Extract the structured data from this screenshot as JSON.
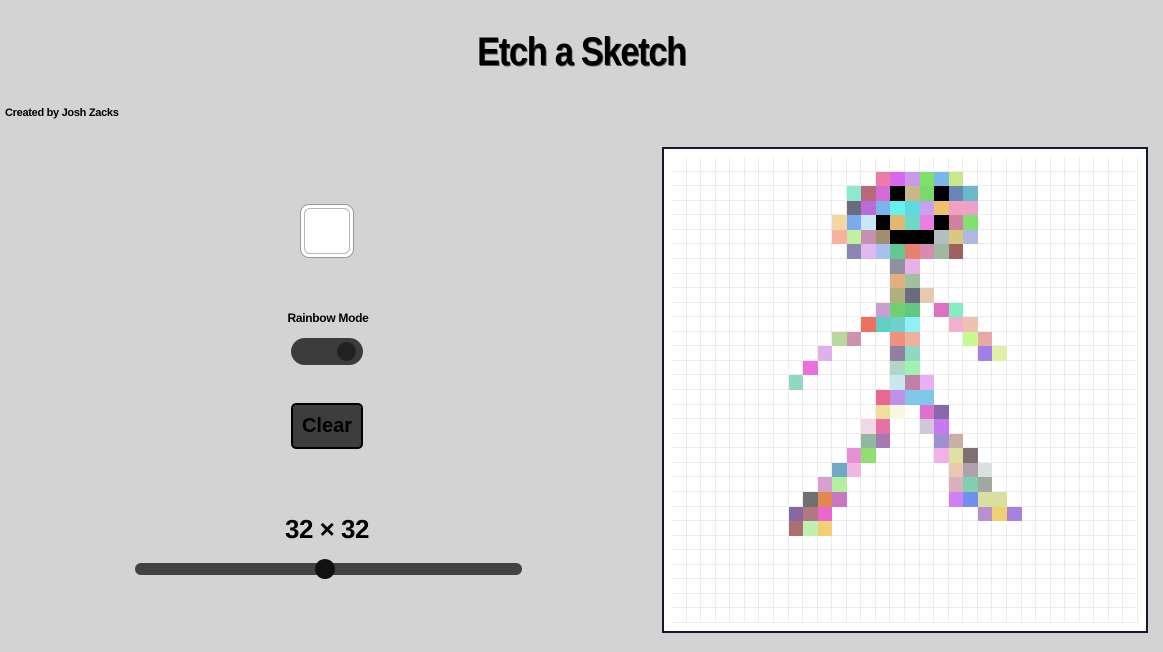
{
  "app": {
    "title": "Etch a Sketch",
    "credit": "Created by Josh Zacks"
  },
  "controls": {
    "color_picker_value": "#ffffff",
    "rainbow_label": "Rainbow Mode",
    "rainbow_mode_on": true,
    "clear_label": "Clear",
    "grid_size_label": "32 × 32",
    "grid_size": 32,
    "grid_size_slider_fraction": 0.49
  },
  "colors": {
    "background": "#d3d3d3",
    "control_dark": "#3d3d3d",
    "board_border": "#121830",
    "grid_line": "#ececec",
    "cell_blank": "#ffffff"
  },
  "board": {
    "rows": 32,
    "cols": 32,
    "painted_cells": [
      [
        1,
        14,
        "#ee7aa6"
      ],
      [
        1,
        15,
        "#dd66ee"
      ],
      [
        1,
        16,
        "#c99be6"
      ],
      [
        1,
        17,
        "#7ee06a"
      ],
      [
        1,
        18,
        "#79b9e8"
      ],
      [
        1,
        19,
        "#c9e88a"
      ],
      [
        2,
        12,
        "#8ee8cf"
      ],
      [
        2,
        13,
        "#b56b7a"
      ],
      [
        2,
        14,
        "#d56bd9"
      ],
      [
        2,
        15,
        "#000000"
      ],
      [
        2,
        16,
        "#c9b98a"
      ],
      [
        2,
        17,
        "#7bd86f"
      ],
      [
        2,
        18,
        "#000000"
      ],
      [
        2,
        19,
        "#6a86b9"
      ],
      [
        2,
        20,
        "#6ab9c9"
      ],
      [
        3,
        12,
        "#6b6b7e"
      ],
      [
        3,
        13,
        "#b96bd9"
      ],
      [
        3,
        14,
        "#7ab4e8"
      ],
      [
        3,
        15,
        "#66f0f0"
      ],
      [
        3,
        16,
        "#5ed9e0"
      ],
      [
        3,
        17,
        "#c8a0f0"
      ],
      [
        3,
        18,
        "#f0c070"
      ],
      [
        3,
        19,
        "#f0a0c0"
      ],
      [
        3,
        20,
        "#f0a0c8"
      ],
      [
        4,
        11,
        "#f0d8a0"
      ],
      [
        4,
        12,
        "#7aaaf0"
      ],
      [
        4,
        13,
        "#c8e8f8"
      ],
      [
        4,
        14,
        "#000000"
      ],
      [
        4,
        15,
        "#e0b870"
      ],
      [
        4,
        16,
        "#70d8c0"
      ],
      [
        4,
        17,
        "#e880e0"
      ],
      [
        4,
        18,
        "#000000"
      ],
      [
        4,
        19,
        "#d080a0"
      ],
      [
        4,
        20,
        "#80e070"
      ],
      [
        5,
        11,
        "#f8b0a0"
      ],
      [
        5,
        12,
        "#c0f0a0"
      ],
      [
        5,
        13,
        "#c890b0"
      ],
      [
        5,
        14,
        "#a09070"
      ],
      [
        5,
        15,
        "#000000"
      ],
      [
        5,
        16,
        "#000000"
      ],
      [
        5,
        17,
        "#000000"
      ],
      [
        5,
        18,
        "#b0c0c0"
      ],
      [
        5,
        19,
        "#d8c880"
      ],
      [
        5,
        20,
        "#b0b8e0"
      ],
      [
        6,
        12,
        "#8888b0"
      ],
      [
        6,
        13,
        "#e0b8f0"
      ],
      [
        6,
        14,
        "#a8c0f0"
      ],
      [
        6,
        15,
        "#60c890"
      ],
      [
        6,
        16,
        "#e88070"
      ],
      [
        6,
        17,
        "#d88ab0"
      ],
      [
        6,
        18,
        "#a0b8a0"
      ],
      [
        6,
        19,
        "#a06060"
      ],
      [
        7,
        15,
        "#9090a0"
      ],
      [
        7,
        16,
        "#e8b0e8"
      ],
      [
        8,
        15,
        "#e0b080"
      ],
      [
        8,
        16,
        "#a0c0a0"
      ],
      [
        9,
        15,
        "#b0b080"
      ],
      [
        9,
        16,
        "#6a6a80"
      ],
      [
        9,
        17,
        "#e8c8b0"
      ],
      [
        10,
        14,
        "#c8a0d0"
      ],
      [
        10,
        15,
        "#70d070"
      ],
      [
        10,
        16,
        "#60c880"
      ],
      [
        10,
        18,
        "#e070c0"
      ],
      [
        10,
        19,
        "#80f0c0"
      ],
      [
        11,
        13,
        "#f07060"
      ],
      [
        11,
        14,
        "#60d0c0"
      ],
      [
        11,
        15,
        "#70d0d0"
      ],
      [
        11,
        16,
        "#90f0f8"
      ],
      [
        11,
        19,
        "#f0b0d0"
      ],
      [
        11,
        20,
        "#f0c0b0"
      ],
      [
        12,
        11,
        "#b8d8a0"
      ],
      [
        12,
        12,
        "#d090b0"
      ],
      [
        12,
        15,
        "#f09080"
      ],
      [
        12,
        16,
        "#f0b0a0"
      ],
      [
        12,
        20,
        "#c8f890"
      ],
      [
        12,
        21,
        "#e8a8a8"
      ],
      [
        13,
        10,
        "#e0b0e8"
      ],
      [
        13,
        15,
        "#9080a0"
      ],
      [
        13,
        16,
        "#90d8c0"
      ],
      [
        13,
        21,
        "#a080e8"
      ],
      [
        13,
        22,
        "#e0f0a8"
      ],
      [
        14,
        9,
        "#e870d8"
      ],
      [
        14,
        15,
        "#b0d8c8"
      ],
      [
        14,
        16,
        "#a0f0b0"
      ],
      [
        15,
        8,
        "#90d8c0"
      ],
      [
        15,
        15,
        "#c8e8f0"
      ],
      [
        15,
        16,
        "#c080a8"
      ],
      [
        15,
        17,
        "#e8b0f0"
      ],
      [
        16,
        14,
        "#e86890"
      ],
      [
        16,
        15,
        "#c090e8"
      ],
      [
        16,
        16,
        "#80c8e8"
      ],
      [
        16,
        17,
        "#80c8e8"
      ],
      [
        17,
        14,
        "#f0e0a0"
      ],
      [
        17,
        15,
        "#f8f8e0"
      ],
      [
        17,
        17,
        "#e070d0"
      ],
      [
        17,
        18,
        "#8868a8"
      ],
      [
        18,
        13,
        "#f0d8e8"
      ],
      [
        18,
        14,
        "#e870a8"
      ],
      [
        18,
        17,
        "#d0c8d8"
      ],
      [
        18,
        18,
        "#c878f0"
      ],
      [
        19,
        13,
        "#90b8a0"
      ],
      [
        19,
        14,
        "#a878b0"
      ],
      [
        19,
        18,
        "#a090d0"
      ],
      [
        19,
        19,
        "#c8b0a8"
      ],
      [
        20,
        12,
        "#e890d8"
      ],
      [
        20,
        13,
        "#90e070"
      ],
      [
        20,
        18,
        "#f0b0e8"
      ],
      [
        20,
        19,
        "#e0e0a0"
      ],
      [
        20,
        20,
        "#807070"
      ],
      [
        21,
        11,
        "#70a8c8"
      ],
      [
        21,
        12,
        "#f0b8e0"
      ],
      [
        21,
        19,
        "#e8c8b0"
      ],
      [
        21,
        20,
        "#b0a0b0"
      ],
      [
        21,
        21,
        "#d8e0e0"
      ],
      [
        22,
        10,
        "#d8a0d0"
      ],
      [
        22,
        11,
        "#b0f0a0"
      ],
      [
        22,
        19,
        "#d8b0c0"
      ],
      [
        22,
        20,
        "#80d0b0"
      ],
      [
        22,
        21,
        "#a0a8a0"
      ],
      [
        23,
        9,
        "#707070"
      ],
      [
        23,
        10,
        "#e08850"
      ],
      [
        23,
        11,
        "#c878c0"
      ],
      [
        23,
        19,
        "#d080f0"
      ],
      [
        23,
        20,
        "#7090f0"
      ],
      [
        23,
        21,
        "#d8e0a0"
      ],
      [
        23,
        22,
        "#d8e0a0"
      ],
      [
        24,
        8,
        "#8868a0"
      ],
      [
        24,
        9,
        "#b07880"
      ],
      [
        24,
        10,
        "#e868d0"
      ],
      [
        24,
        21,
        "#b890d0"
      ],
      [
        24,
        22,
        "#f0d070"
      ],
      [
        24,
        23,
        "#a880e0"
      ],
      [
        25,
        8,
        "#a87070"
      ],
      [
        25,
        9,
        "#c0f0b0"
      ],
      [
        25,
        10,
        "#f0d070"
      ]
    ]
  }
}
